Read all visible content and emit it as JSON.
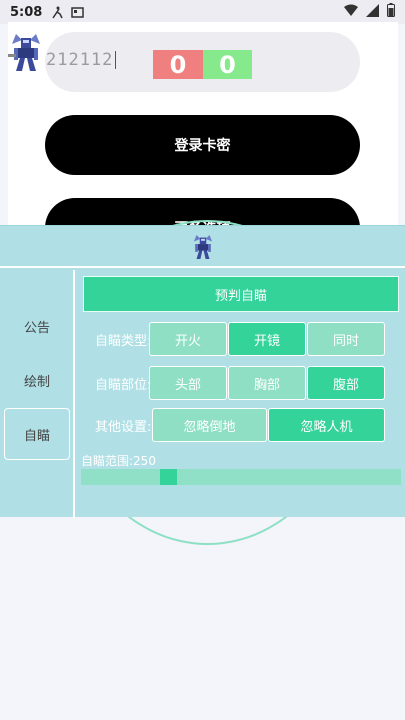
{
  "status_bar": {
    "time": "5:08",
    "icons": [
      "accessibility-icon",
      "gallery-icon",
      "wifi-icon",
      "signal-icon",
      "battery-icon"
    ]
  },
  "login": {
    "card_code": "212112",
    "score_left": "0",
    "score_right": "0",
    "login_button": "登录卡密",
    "second_button": "更多选项"
  },
  "panel": {
    "sidebar": [
      {
        "label": "公告",
        "selected": false
      },
      {
        "label": "绘制",
        "selected": false
      },
      {
        "label": "自瞄",
        "selected": true
      }
    ],
    "predict_button": "预判自瞄",
    "rows": [
      {
        "label": "自瞄类型:",
        "options": [
          {
            "label": "开火",
            "on": false
          },
          {
            "label": "开镜",
            "on": true
          },
          {
            "label": "同时",
            "on": false
          }
        ]
      },
      {
        "label": "自瞄部位:",
        "options": [
          {
            "label": "头部",
            "on": false
          },
          {
            "label": "胸部",
            "on": false
          },
          {
            "label": "腹部",
            "on": true
          }
        ]
      },
      {
        "label": "其他设置:",
        "options": [
          {
            "label": "忽略倒地",
            "on": false
          },
          {
            "label": "忽略人机",
            "on": true
          }
        ]
      }
    ],
    "range_label": "自瞄范围:250",
    "range_value": 250
  },
  "colors": {
    "accent": "#34d399",
    "panel": "#b0e0e6",
    "score_red": "#f07f7f",
    "score_green": "#86ea8c"
  }
}
